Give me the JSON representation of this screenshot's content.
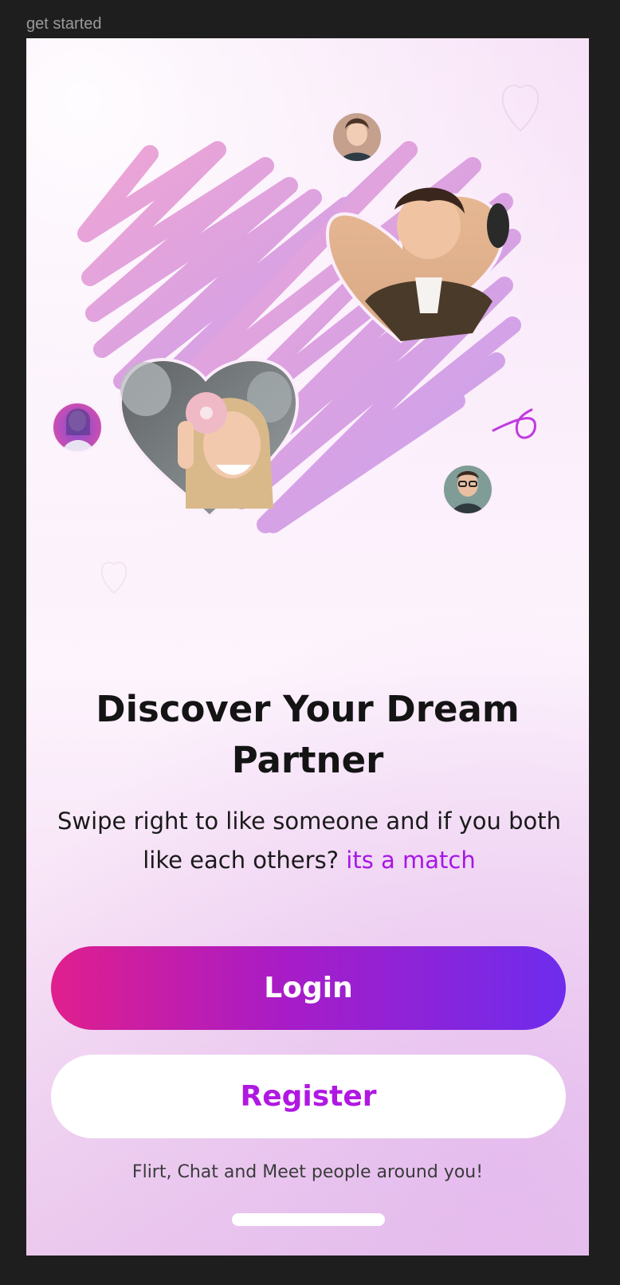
{
  "frame": {
    "label": "get started"
  },
  "hero": {
    "profile_photos": [
      "curly-haired-man",
      "woman-with-donut",
      "woman-neon",
      "man-small",
      "man-glasses"
    ],
    "scribble_colors": [
      "#ec9fd4",
      "#c99cea"
    ]
  },
  "headline": {
    "line1": "Discover Your Dream",
    "line2": "Partner"
  },
  "subtitle": {
    "text": "Swipe right to like someone and if you both like each others?",
    "accent": "its a match"
  },
  "buttons": {
    "login": "Login",
    "register": "Register"
  },
  "tagline": "Flirt, Chat and Meet people around you!",
  "colors": {
    "accent": "#a617e4",
    "gradient_start": "#e01f8d",
    "gradient_end": "#6e2ced"
  }
}
